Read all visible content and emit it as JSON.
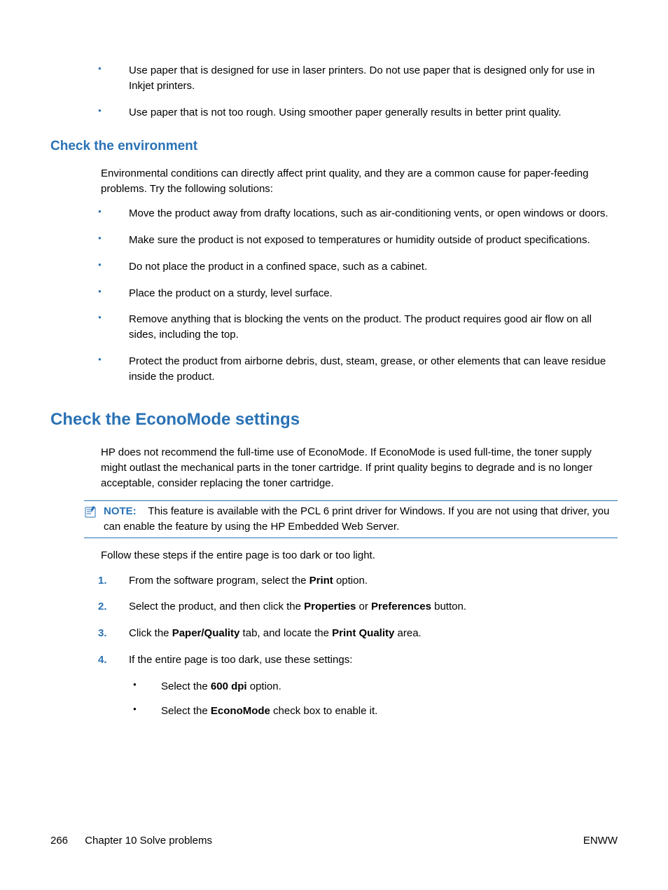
{
  "top_bullets": [
    "Use paper that is designed for use in laser printers. Do not use paper that is designed only for use in Inkjet printers.",
    "Use paper that is not too rough. Using smoother paper generally results in better print quality."
  ],
  "env_heading": "Check the environment",
  "env_intro": "Environmental conditions can directly affect print quality, and they are a common cause for paper-feeding problems. Try the following solutions:",
  "env_bullets": [
    "Move the product away from drafty locations, such as air-conditioning vents, or open windows or doors.",
    "Make sure the product is not exposed to temperatures or humidity outside of product specifications.",
    "Do not place the product in a confined space, such as a cabinet.",
    "Place the product on a sturdy, level surface.",
    "Remove anything that is blocking the vents on the product. The product requires good air flow on all sides, including the top.",
    "Protect the product from airborne debris, dust, steam, grease, or other elements that can leave residue inside the product."
  ],
  "econo_heading": "Check the EconoMode settings",
  "econo_intro": "HP does not recommend the full-time use of EconoMode. If EconoMode is used full-time, the toner supply might outlast the mechanical parts in the toner cartridge. If print quality begins to degrade and is no longer acceptable, consider replacing the toner cartridge.",
  "note_label": "NOTE:",
  "note_text": "This feature is available with the PCL 6 print driver for Windows. If you are not using that driver, you can enable the feature by using the HP Embedded Web Server.",
  "steps_intro": "Follow these steps if the entire page is too dark or too light.",
  "steps": {
    "s1a": "From the software program, select the ",
    "s1b": "Print",
    "s1c": " option.",
    "s2a": "Select the product, and then click the ",
    "s2b": "Properties",
    "s2c": " or ",
    "s2d": "Preferences",
    "s2e": " button.",
    "s3a": "Click the ",
    "s3b": "Paper/Quality",
    "s3c": " tab, and locate the ",
    "s3d": "Print Quality",
    "s3e": " area.",
    "s4": "If the entire page is too dark, use these settings:"
  },
  "sub_bullets": {
    "b1a": "Select the ",
    "b1b": "600 dpi",
    "b1c": " option.",
    "b2a": "Select the ",
    "b2b": "EconoMode",
    "b2c": " check box to enable it."
  },
  "footer": {
    "page": "266",
    "chapter": "Chapter 10   Solve problems",
    "right": "ENWW"
  }
}
